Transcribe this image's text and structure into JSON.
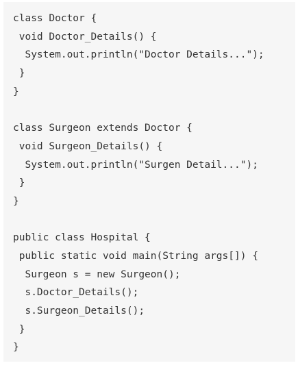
{
  "code": {
    "lines": [
      "class Doctor {",
      " void Doctor_Details() {",
      "  System.out.println(\"Doctor Details...\");",
      " }",
      "}",
      "",
      "class Surgeon extends Doctor {",
      " void Surgeon_Details() {",
      "  System.out.println(\"Surgen Detail...\");",
      " }",
      "}",
      "",
      "public class Hospital {",
      " public static void main(String args[]) {",
      "  Surgeon s = new Surgeon();",
      "  s.Doctor_Details();",
      "  s.Surgeon_Details();",
      " }",
      "}"
    ]
  }
}
